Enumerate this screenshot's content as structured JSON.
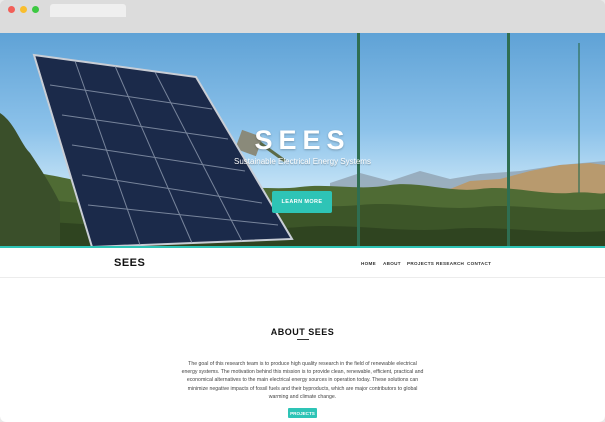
{
  "hero": {
    "title": "SEES",
    "subtitle": "Sustainable Electrical Energy Systems",
    "cta_label": "LEARN MORE"
  },
  "navbar": {
    "brand": "SEES",
    "items": [
      {
        "label": "HOME"
      },
      {
        "label": "ABOUT"
      },
      {
        "label": "PROJECTS"
      },
      {
        "label": "RESEARCH"
      },
      {
        "label": "CONTACT"
      }
    ]
  },
  "about": {
    "title": "ABOUT SEES",
    "body": "The goal of this research team is to produce high quality research in the field of renewable electrical energy systems. The motivation behind this mission is to provide clean, renewable, efficient, practical and economical alternatives to the main electrical energy sources in operation today. These solutions can minimize negative impacts of fossil fuels and their byproducts, which are major contributors to global warming and climate change.",
    "button_label": "PROJECTS"
  },
  "colors": {
    "accent": "#2ec4b6",
    "window_close": "#f25f58",
    "window_minimize": "#f9be2e",
    "window_maximize": "#3dc942"
  }
}
